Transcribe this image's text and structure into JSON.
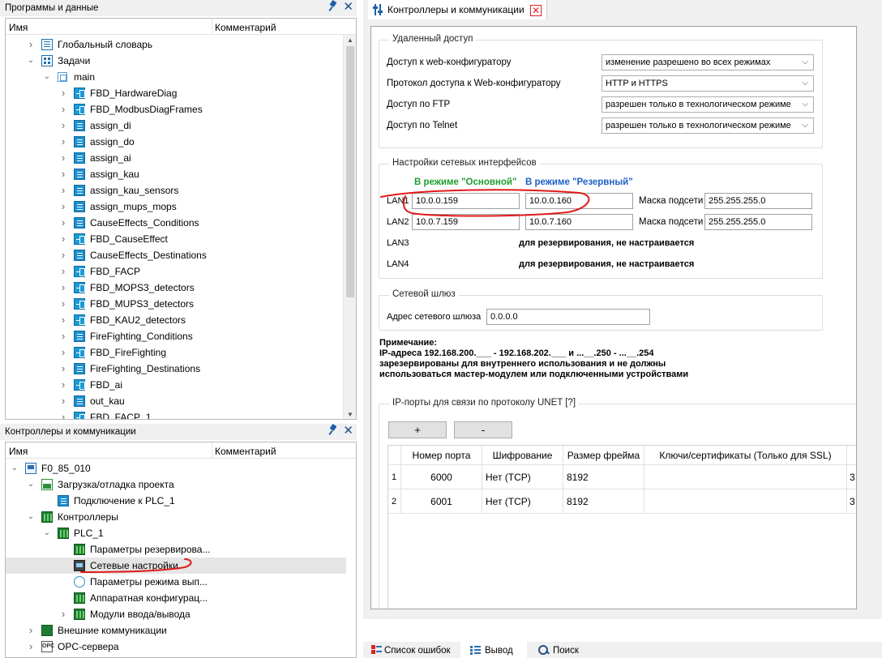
{
  "programs_panel": {
    "title": "Программы и данные",
    "col_name": "Имя",
    "col_comment": "Комментарий",
    "items": [
      {
        "label": "Глобальный словарь",
        "icon": "dictionary-icon"
      },
      {
        "label": "Задачи",
        "icon": "tasks-icon"
      },
      {
        "label": "main",
        "icon": "task-main-icon"
      },
      {
        "label": "FBD_HardwareDiag",
        "icon": "fbd-icon"
      },
      {
        "label": "FBD_ModbusDiagFrames",
        "icon": "fbd-icon"
      },
      {
        "label": "assign_di",
        "icon": "document-icon"
      },
      {
        "label": "assign_do",
        "icon": "document-icon"
      },
      {
        "label": "assign_ai",
        "icon": "document-icon"
      },
      {
        "label": "assign_kau",
        "icon": "document-icon"
      },
      {
        "label": "assign_kau_sensors",
        "icon": "document-icon"
      },
      {
        "label": "assign_mups_mops",
        "icon": "document-icon"
      },
      {
        "label": "CauseEffects_Conditions",
        "icon": "document-icon"
      },
      {
        "label": "FBD_CauseEffect",
        "icon": "fbd-icon"
      },
      {
        "label": "CauseEffects_Destinations",
        "icon": "document-icon"
      },
      {
        "label": "FBD_FACP",
        "icon": "fbd-icon"
      },
      {
        "label": "FBD_MOPS3_detectors",
        "icon": "fbd-icon"
      },
      {
        "label": "FBD_MUPS3_detectors",
        "icon": "fbd-icon"
      },
      {
        "label": "FBD_KAU2_detectors",
        "icon": "fbd-icon"
      },
      {
        "label": "FireFighting_Conditions",
        "icon": "document-icon"
      },
      {
        "label": "FBD_FireFighting",
        "icon": "fbd-icon"
      },
      {
        "label": "FireFighting_Destinations",
        "icon": "document-icon"
      },
      {
        "label": "FBD_ai",
        "icon": "fbd-icon"
      },
      {
        "label": "out_kau",
        "icon": "document-icon"
      },
      {
        "label": "FBD_FACP_1",
        "icon": "fbd-icon"
      }
    ]
  },
  "controllers_panel": {
    "title": "Контроллеры и коммуникации",
    "col_name": "Имя",
    "col_comment": "Комментарий",
    "items": [
      {
        "label": "F0_85_010",
        "icon": "project-icon"
      },
      {
        "label": "Загрузка/отладка проекта",
        "icon": "load-debug-icon"
      },
      {
        "label": "Подключение к PLC_1",
        "icon": "connection-icon"
      },
      {
        "label": "Контроллеры",
        "icon": "controllers-icon"
      },
      {
        "label": "PLC_1",
        "icon": "plc-icon"
      },
      {
        "label": "Параметры резервирова...",
        "icon": "redundancy-icon"
      },
      {
        "label": "Сетевые настройки",
        "icon": "network-settings-icon"
      },
      {
        "label": "Параметры режима вып...",
        "icon": "mode-params-icon"
      },
      {
        "label": "Аппаратная конфигурац...",
        "icon": "hardware-config-icon"
      },
      {
        "label": "Модули ввода/вывода",
        "icon": "io-modules-icon"
      },
      {
        "label": "Внешние коммуникации",
        "icon": "external-comm-icon"
      },
      {
        "label": "OPC-сервера",
        "icon": "opc-icon"
      }
    ]
  },
  "editor_tab": {
    "title": "Контроллеры и коммуникации"
  },
  "remote_access": {
    "title": "Удаленный доступ",
    "rows": [
      {
        "label": "Доступ к web-конфигуратору",
        "value": "изменение разрешено во всех режимах"
      },
      {
        "label": "Протокол доступа к Web-конфигуратору",
        "value": "HTTP и HTTPS"
      },
      {
        "label": "Доступ по FTP",
        "value": "разрешен только в технологическом режиме"
      },
      {
        "label": "Доступ по Telnet",
        "value": "разрешен только в технологическом режиме"
      }
    ]
  },
  "network": {
    "title": "Настройки сетевых интерфейсов",
    "main_mode_label": "В режиме \"Основной\"",
    "reserve_mode_label": "В режиме \"Резервный\"",
    "mask_label": "Маска подсети",
    "lan1": {
      "name": "LAN1",
      "main": "10.0.0.159",
      "reserve": "10.0.0.160",
      "mask": "255.255.255.0"
    },
    "lan2": {
      "name": "LAN2",
      "main": "10.0.7.159",
      "reserve": "10.0.7.160",
      "mask": "255.255.255.0"
    },
    "lan3": {
      "name": "LAN3",
      "note": "для резервирования, не настраивается"
    },
    "lan4": {
      "name": "LAN4",
      "note": "для резервирования, не настраивается"
    },
    "main_mode_color": "#1e9e2e",
    "reserve_mode_color": "#1f5fc8"
  },
  "gateway": {
    "title": "Сетевой шлюз",
    "label": "Адрес сетевого шлюза",
    "value": "0.0.0.0"
  },
  "note": {
    "title": "Примечание:",
    "line1": "IP-адреса 192.168.200.___ - 192.168.202.___ и ...__.250 - ...__.254",
    "line2": "зарезервированы для внутреннего использования и не должны",
    "line3": "использоваться мастер-модулем или подключенными устройствами"
  },
  "unet": {
    "title": "IP-порты для связи по протоколу UNET [?]",
    "add_label": "+",
    "remove_label": "-",
    "headers": [
      "Номер порта",
      "Шифрование",
      "Размер фрейма",
      "Ключи/сертификаты (Только для SSL)"
    ],
    "rows": [
      {
        "num": "1",
        "port": "6000",
        "enc": "Нет (TCP)",
        "frame": "8192",
        "keys": "",
        "tail": "3"
      },
      {
        "num": "2",
        "port": "6001",
        "enc": "Нет (TCP)",
        "frame": "8192",
        "keys": "",
        "tail": "3"
      }
    ]
  },
  "bottom_tabs": {
    "errors": "Список ошибок",
    "output": "Вывод",
    "search": "Поиск"
  },
  "colors": {
    "annotation": "#e01a1a",
    "selection": "#e5e5e5"
  }
}
